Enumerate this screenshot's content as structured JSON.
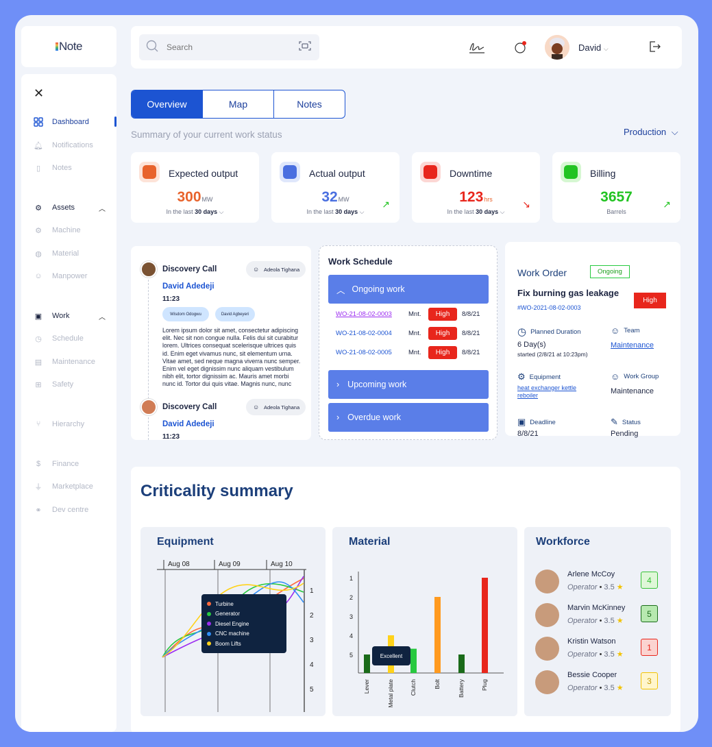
{
  "app": {
    "logo": "Note"
  },
  "sidebar": {
    "items": [
      {
        "label": "Dashboard"
      },
      {
        "label": "Notifications"
      },
      {
        "label": "Notes"
      },
      {
        "label": "Assets"
      },
      {
        "label": "Machine"
      },
      {
        "label": "Material"
      },
      {
        "label": "Manpower"
      },
      {
        "label": "Work"
      },
      {
        "label": "Schedule"
      },
      {
        "label": "Maintenance"
      },
      {
        "label": "Safety"
      },
      {
        "label": "Hierarchy"
      },
      {
        "label": "Finance"
      },
      {
        "label": "Marketplace"
      },
      {
        "label": "Dev centre"
      }
    ]
  },
  "header": {
    "search_placeholder": "Search",
    "user": "David"
  },
  "tabs": [
    {
      "label": "Overview"
    },
    {
      "label": "Map"
    },
    {
      "label": "Notes"
    }
  ],
  "summary": {
    "title": "Summary of your current work status",
    "filter": "Production"
  },
  "kpis": [
    {
      "title": "Expected output",
      "value": "300",
      "unit": "MW",
      "pre": "In the last ",
      "period": "30 days",
      "color": "#e8632c"
    },
    {
      "title": "Actual output",
      "value": "32",
      "unit": "MW",
      "pre": "In the last ",
      "period": "30 days",
      "color": "#4a6fe0"
    },
    {
      "title": "Downtime",
      "value": "123",
      "unit": "hrs",
      "pre": "In the last ",
      "period": "30 days",
      "color": "#e8261c"
    },
    {
      "title": "Billing",
      "value": "3657",
      "unit": "",
      "sub": "Barrels",
      "color": "#22c322"
    }
  ],
  "calls": [
    {
      "title": "Discovery Call",
      "assignee": "Adeola Tighana",
      "name": "David Adedeji",
      "time": "11:23",
      "tags": [
        "Wisdom Odogwu",
        "David Agbeyeri"
      ],
      "body": "Lorem ipsum dolor sit amet, consectetur adipiscing elit. Nec sit non congue nulla. Felis dui sit curabitur lorem. Ultrices consequat scelerisque ultrices quis id. Enim eget vivamus nunc, sit elementum urna. Vitae amet, sed neque magna viverra nunc semper. Enim vel eget dignissim nunc aliquam vestibulum nibh elit, tortor dignissim ac. Mauris amet morbi nunc id. Tortor dui quis vitae. Magnis nunc, nunc genae"
    },
    {
      "title": "Discovery Call",
      "assignee": "Adeola Tighana",
      "name": "David Adedeji",
      "time": "11:23"
    }
  ],
  "schedule": {
    "title": "Work Schedule",
    "ongoing": "Ongoing work",
    "rows": [
      {
        "id": "WO-21-08-02-0003",
        "type": "Mnt.",
        "priority": "High",
        "date": "8/8/21"
      },
      {
        "id": "WO-21-08-02-0004",
        "type": "Mnt.",
        "priority": "High",
        "date": "8/8/21"
      },
      {
        "id": "WO-21-08-02-0005",
        "type": "Mnt.",
        "priority": "High",
        "date": "8/8/21"
      }
    ],
    "upcoming": "Upcoming work",
    "overdue": "Overdue work"
  },
  "work_order": {
    "title": "Work Order",
    "status_badge": "Ongoing",
    "task": "Fix burning gas leakage",
    "priority": "High",
    "code": "#WO-2021-08-02-0003",
    "planned_label": "Planned Duration",
    "planned_value": "6 Day(s)",
    "planned_started": "started (2/8/21  at 10:23pm)",
    "team_label": "Team",
    "team_value": "Maintenance",
    "equip_label": "Equipment",
    "equip_value": "heat exchanger kettle reboiler",
    "group_label": "Work Group",
    "group_value": "Maintenance",
    "deadline_label": "Deadline",
    "deadline_value": "8/8/21",
    "status_label": "Status",
    "status_value": "Pending"
  },
  "criticality": {
    "title": "Criticality summary",
    "equipment": {
      "title": "Equipment",
      "legend": [
        "Turbine",
        "Generator",
        "Diesel Engine",
        "CNC machine",
        "Boom Lifts"
      ],
      "legend_colors": [
        "#ff6a3d",
        "#27c93f",
        "#9b2cf0",
        "#2f8df6",
        "#ffd21a"
      ]
    },
    "material": {
      "title": "Material",
      "tooltip": "Excellent"
    },
    "workforce": {
      "title": "Workforce",
      "people": [
        {
          "name": "Arlene McCoy",
          "role": "Operator",
          "rating": "3.5",
          "score": "4",
          "color": "#35c135",
          "bg": "#dff7d8"
        },
        {
          "name": "Marvin McKinney",
          "role": "Operator",
          "rating": "3.5",
          "score": "5",
          "color": "#1a6b1a",
          "bg": "#b7e9b0"
        },
        {
          "name": "Kristin Watson",
          "role": "Operator",
          "rating": "3.5",
          "score": "1",
          "color": "#e8261c",
          "bg": "#fbd3d0"
        },
        {
          "name": "Bessie Cooper",
          "role": "Operator",
          "rating": "3.5",
          "score": "3",
          "color": "#f2c200",
          "bg": "#fff6cc"
        }
      ]
    }
  },
  "chart_data": [
    {
      "type": "line",
      "title": "Equipment",
      "x": [
        "Aug 08",
        "Aug 09",
        "Aug 10"
      ],
      "yticks": [
        "1",
        "2",
        "3",
        "4",
        "5"
      ],
      "series": [
        {
          "name": "Turbine"
        },
        {
          "name": "Generator"
        },
        {
          "name": "Diesel Engine"
        },
        {
          "name": "CNC machine"
        },
        {
          "name": "Boom Lifts"
        }
      ]
    },
    {
      "type": "bar",
      "title": "Material",
      "categories": [
        "Lever",
        "Metal plate",
        "Clutch",
        "Bolt",
        "Battery",
        "Plug"
      ],
      "values": [
        5,
        4,
        4.7,
        2,
        5,
        1
      ],
      "colors": [
        "#1a6b1a",
        "#ffd21a",
        "#27c93f",
        "#ff9a1f",
        "#1a6b1a",
        "#e8261c"
      ],
      "yticks": [
        "1",
        "2",
        "3",
        "4",
        "5"
      ],
      "tooltip": "Excellent"
    }
  ]
}
